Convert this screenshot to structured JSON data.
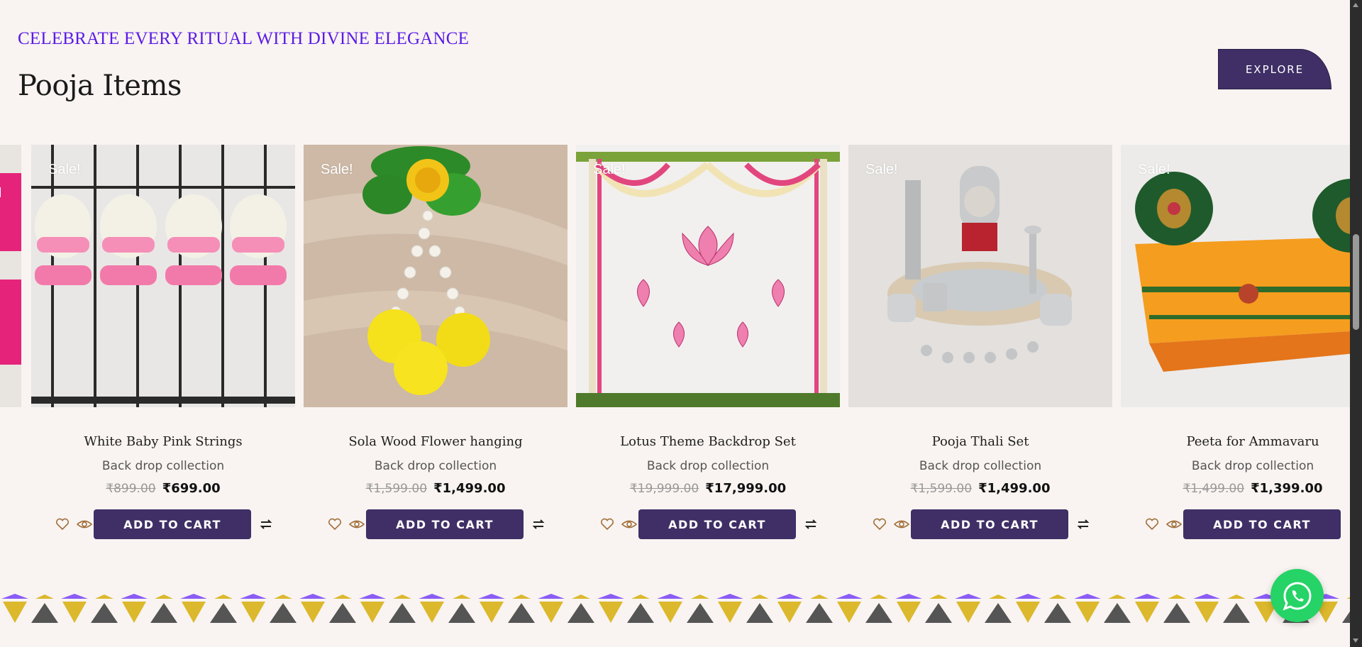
{
  "header": {
    "tagline": "CELEBRATE EVERY RITUAL WITH DIVINE ELEGANCE",
    "title": "Pooja Items",
    "explore_label": "EXPLORE"
  },
  "colors": {
    "accent_purple": "#3f2f66",
    "tagline_color": "#5b1be6",
    "background": "#f9f4f1",
    "whatsapp_green": "#25d366"
  },
  "products": [
    {
      "sale_badge": "Sale!",
      "name": "White Baby Pink Strings",
      "category": "Back drop collection",
      "old_price": "₹899.00",
      "price": "₹699.00",
      "cart_label": "ADD TO CART"
    },
    {
      "sale_badge": "Sale!",
      "name": "Sola Wood Flower hanging",
      "category": "Back drop collection",
      "old_price": "₹1,599.00",
      "price": "₹1,499.00",
      "cart_label": "ADD TO CART"
    },
    {
      "sale_badge": "Sale!",
      "name": "Lotus Theme Backdrop Set",
      "category": "Back drop collection",
      "old_price": "₹19,999.00",
      "price": "₹17,999.00",
      "cart_label": "ADD TO CART"
    },
    {
      "sale_badge": "Sale!",
      "name": "Pooja Thali Set",
      "category": "Back drop collection",
      "old_price": "₹1,599.00",
      "price": "₹1,499.00",
      "cart_label": "ADD TO CART"
    },
    {
      "sale_badge": "Sale!",
      "name": "Peeta for Ammavaru",
      "category": "Back drop collection",
      "old_price": "₹1,499.00",
      "price": "₹1,399.00",
      "cart_label": "ADD TO CART"
    }
  ],
  "icons": {
    "wishlist": "heart-icon",
    "quick_view": "eye-icon",
    "compare": "compare-icon",
    "chat": "whatsapp-icon"
  }
}
